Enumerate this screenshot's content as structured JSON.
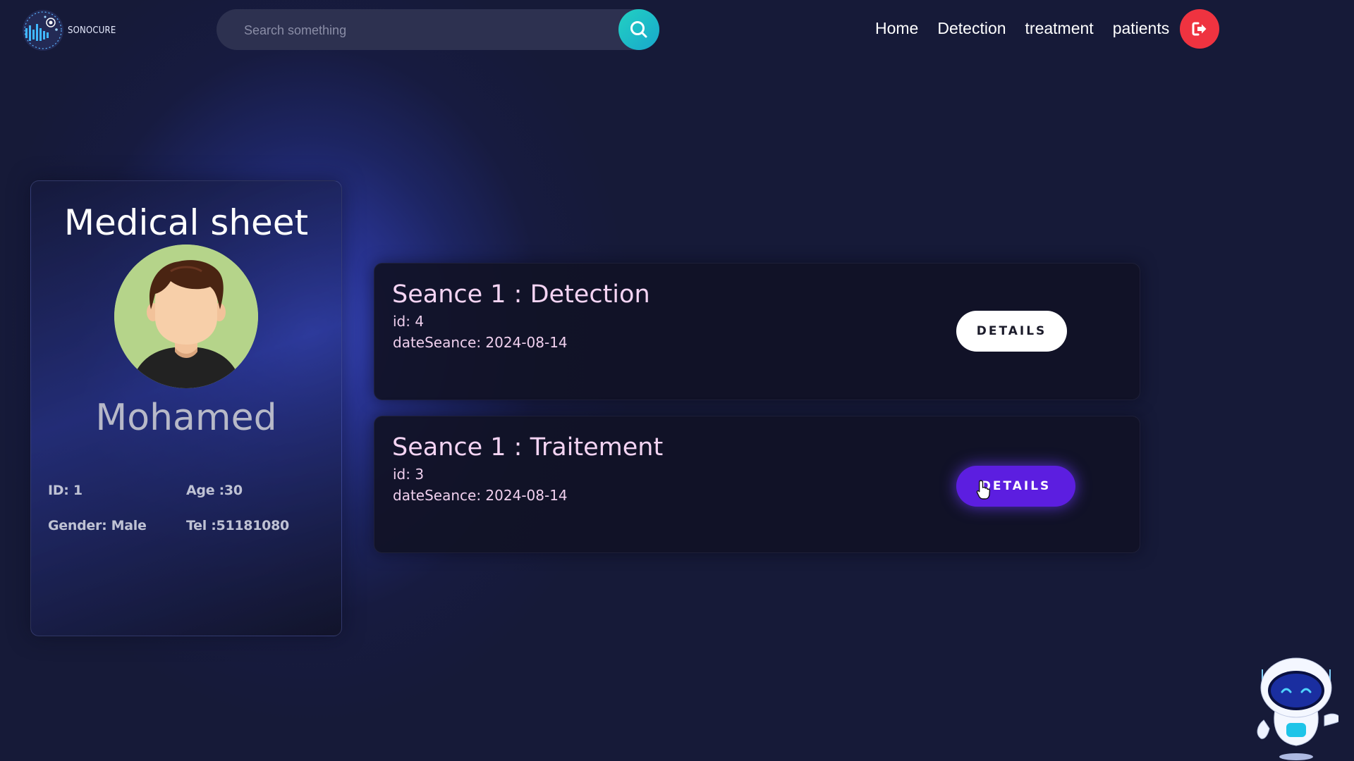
{
  "header": {
    "logo_text": "SONOCURE",
    "search_placeholder": "Search something",
    "nav": [
      "Home",
      "Detection",
      "treatment",
      "patients"
    ]
  },
  "sheet": {
    "title": "Medical sheet",
    "patient_name": "Mohamed",
    "id_label": "ID: 1",
    "age_label": "Age :30",
    "gender_label": "Gender: Male",
    "tel_label": "Tel :51181080"
  },
  "seances": [
    {
      "title": "Seance 1 : Detection",
      "id_line": "id: 4",
      "date_line": "dateSeance: 2024-08-14",
      "button_label": "DETAILS"
    },
    {
      "title": "Seance 1 : Traitement",
      "id_line": "id: 3",
      "date_line": "dateSeance: 2024-08-14",
      "button_label": "DETAILS"
    }
  ],
  "colors": {
    "background": "#161a38",
    "accent_search": "#22d1c2",
    "logout": "#ef3340",
    "button_active": "#5c1ee0",
    "seance_title": "#f4d4f3"
  },
  "icons": {
    "search": "search-icon",
    "logout": "logout-icon",
    "assistant": "robot-assistant-icon"
  }
}
